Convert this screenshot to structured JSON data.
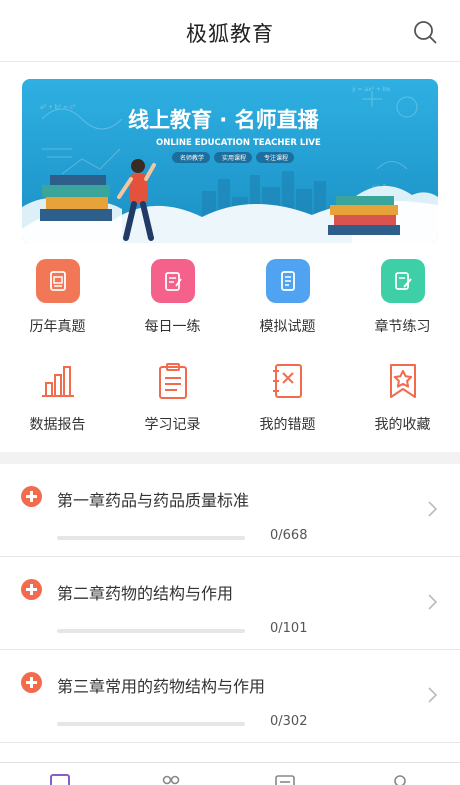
{
  "app": {
    "title": "极狐教育"
  },
  "header": {
    "search_icon": "search-icon"
  },
  "banner": {
    "title": "线上教育 · 名师直播",
    "subtitle": "ONLINE EDUCATION TEACHER LIVE",
    "tags": [
      "名师教学",
      "实用课程",
      "专注课程"
    ],
    "bg_color": "#2aa6d8"
  },
  "grid": {
    "row1": [
      {
        "label": "历年真题",
        "icon": "past-exam-icon",
        "color": "#f27757"
      },
      {
        "label": "每日一练",
        "icon": "daily-practice-icon",
        "color": "#f4628c"
      },
      {
        "label": "模拟试题",
        "icon": "mock-test-icon",
        "color": "#4fa3f0"
      },
      {
        "label": "章节练习",
        "icon": "chapter-practice-icon",
        "color": "#3ecfa6"
      }
    ],
    "row2": [
      {
        "label": "数据报告",
        "icon": "bar-chart-icon"
      },
      {
        "label": "学习记录",
        "icon": "clipboard-icon"
      },
      {
        "label": "我的错题",
        "icon": "wrong-questions-icon"
      },
      {
        "label": "我的收藏",
        "icon": "favorite-icon"
      }
    ],
    "line_color": "#f26b4d"
  },
  "chapters": [
    {
      "name": "第一章药品与药品质量标准",
      "count": "0/668",
      "progress": 0
    },
    {
      "name": "第二章药物的结构与作用",
      "count": "0/101",
      "progress": 0
    },
    {
      "name": "第三章常用的药物结构与作用",
      "count": "0/302",
      "progress": 0
    }
  ],
  "tabbar": {
    "icons": [
      "home-icon",
      "community-icon",
      "course-icon",
      "profile-icon"
    ]
  }
}
